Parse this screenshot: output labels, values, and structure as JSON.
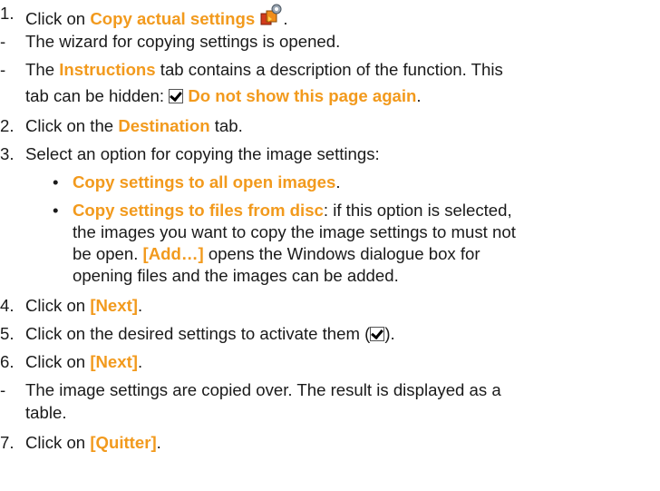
{
  "steps": {
    "s1": {
      "marker": "1.",
      "pre": "Click on ",
      "hl": "Copy actual settings",
      "post": "."
    },
    "r1": {
      "marker": "-",
      "text": "The wizard for copying settings is opened."
    },
    "r2": {
      "marker": "-",
      "pre": "The ",
      "hl": "Instructions",
      "post": " tab contains a description of the function. This",
      "cont_pre": "tab can be hidden: ",
      "cont_hl": "Do not show this page again",
      "cont_post": "."
    },
    "s2": {
      "marker": "2.",
      "pre": "Click on the ",
      "hl": "Destination",
      "post": " tab."
    },
    "s3": {
      "marker": "3.",
      "text": "Select an option for copying the image settings:"
    },
    "b1": {
      "marker": "•",
      "hl": "Copy settings to all open images",
      "post": "."
    },
    "b2": {
      "marker": "•",
      "hl": "Copy settings to files from disc",
      "post": ": if this option is selected,",
      "line2": "the images you want to copy the image settings to must not",
      "line3_pre": "be open. ",
      "line3_hl": "[Add…]",
      "line3_post": " opens the Windows dialogue box for",
      "line4": "opening files and the images can be added."
    },
    "s4": {
      "marker": "4.",
      "pre": "Click on ",
      "hl": "[Next]",
      "post": "."
    },
    "s5": {
      "marker": "5.",
      "pre": "Click on the desired settings to activate them (",
      "post": ")."
    },
    "s6": {
      "marker": "6.",
      "pre": "Click on ",
      "hl": "[Next]",
      "post": "."
    },
    "r3": {
      "marker": "-",
      "text": "The image settings are copied over. The result is displayed as a",
      "line2": "table."
    },
    "s7": {
      "marker": "7.",
      "pre": "Click on ",
      "hl": "[Quitter]",
      "post": "."
    }
  },
  "icons": {
    "copy_settings": "copy-settings-icon",
    "checkbox": "checked-checkbox-icon"
  },
  "colors": {
    "highlight": "#f29a1d",
    "text": "#1a1a1a"
  }
}
